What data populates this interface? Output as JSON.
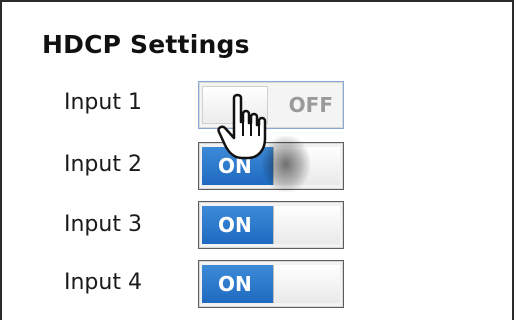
{
  "title": "HDCP Settings",
  "inputs": [
    {
      "label": "Input 1",
      "state_label": "OFF",
      "enabled": false
    },
    {
      "label": "Input 2",
      "state_label": "ON",
      "enabled": true
    },
    {
      "label": "Input 3",
      "state_label": "ON",
      "enabled": true
    },
    {
      "label": "Input 4",
      "state_label": "ON",
      "enabled": true
    }
  ],
  "colors": {
    "on_fill": "#1f6ac0",
    "off_text": "#9a9a9a",
    "border": "#2b2b2b"
  },
  "icons": {
    "cursor": "hand-pointer-icon"
  }
}
